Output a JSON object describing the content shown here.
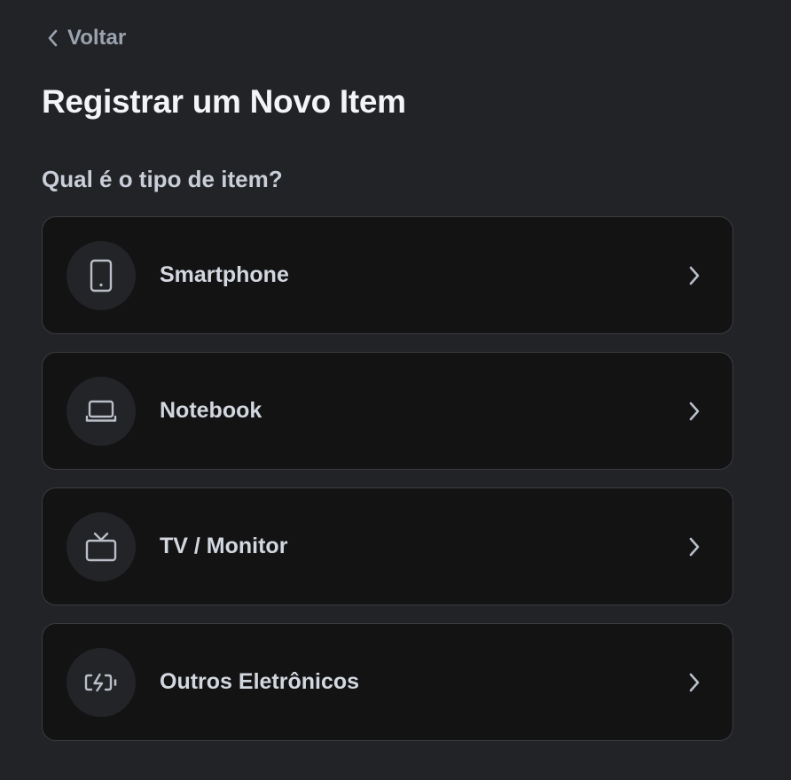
{
  "nav": {
    "back_label": "Voltar",
    "back_icon": "chevron-left-icon"
  },
  "header": {
    "title": "Registrar um Novo Item"
  },
  "form": {
    "question": "Qual é o tipo de item?",
    "options": [
      {
        "label": "Smartphone",
        "icon": "smartphone-icon"
      },
      {
        "label": "Notebook",
        "icon": "laptop-icon"
      },
      {
        "label": "TV / Monitor",
        "icon": "tv-icon"
      },
      {
        "label": "Outros Eletrônicos",
        "icon": "battery-charging-icon"
      }
    ]
  },
  "colors": {
    "background": "#222326",
    "card_background": "#131314",
    "card_border": "#3b3c40",
    "icon_circle": "#232427",
    "title_text": "#f2f4f8",
    "muted_text": "#9ba3b0"
  }
}
